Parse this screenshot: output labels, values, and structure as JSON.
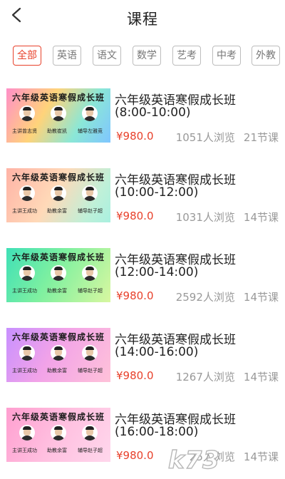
{
  "header": {
    "title": "课程"
  },
  "filters": [
    "全部",
    "英语",
    "语文",
    "数学",
    "艺考",
    "中考",
    "外教"
  ],
  "courses": [
    {
      "thumb_title": "六年级英语寒假成长班",
      "roles": [
        "主讲曾志贤",
        "助教崔凯",
        "辅导左雅竞"
      ],
      "title": "六年级英语寒假成长班",
      "time": "(8:00-10:00)",
      "price": "¥980.0",
      "views": "1051人浏览",
      "lessons": "21节课",
      "gradient": "linear-gradient(120deg,#ff8fc8 0%,#ffd37a 38%,#8be7d6 70%,#7fc6ff 100%)"
    },
    {
      "thumb_title": "六年级英语寒假成长班",
      "roles": [
        "主讲王成功",
        "助教余富",
        "辅导赵子超"
      ],
      "title": "六年级英语寒假成长班",
      "time": "(10:00-12:00)",
      "price": "¥980.0",
      "views": "1031人浏览",
      "lessons": "14节课",
      "gradient": "linear-gradient(120deg,#ffb3a6 0%,#ffd9b8 45%,#bff0d8 80%,#a9f0e0 100%)"
    },
    {
      "thumb_title": "六年级英语寒假成长班",
      "roles": [
        "主讲王成功",
        "助教余富",
        "辅导赵子超"
      ],
      "title": "六年级英语寒假成长班",
      "time": "(12:00-14:00)",
      "price": "¥980.0",
      "views": "2592人浏览",
      "lessons": "14节课",
      "gradient": "linear-gradient(120deg,#3fe0b7 0%,#7ff0a0 45%,#d8f7a0 100%)"
    },
    {
      "thumb_title": "六年级英语寒假成长班",
      "roles": [
        "主讲王成功",
        "助教余富",
        "辅导赵子超"
      ],
      "title": "六年级英语寒假成长班",
      "time": "(14:00-16:00)",
      "price": "¥980.0",
      "views": "1267人浏览",
      "lessons": "14节课",
      "gradient": "linear-gradient(120deg,#c890ff 0%,#f2a3e8 45%,#ffc2d9 100%)"
    },
    {
      "thumb_title": "六年级英语寒假成长班",
      "roles": [
        "主讲王成功",
        "助教余富",
        "辅导赵子超"
      ],
      "title": "六年级英语寒假成长班",
      "time": "(16:00-18:00)",
      "price": "¥980.0",
      "views": "25人浏览",
      "lessons": "14节课",
      "gradient": "linear-gradient(120deg,#ff9fd0 0%,#ffc0e0 50%,#ffd7ec 100%)"
    }
  ],
  "watermark": "k73",
  "colors": {
    "accent": "#e8412b",
    "muted": "#999999"
  }
}
